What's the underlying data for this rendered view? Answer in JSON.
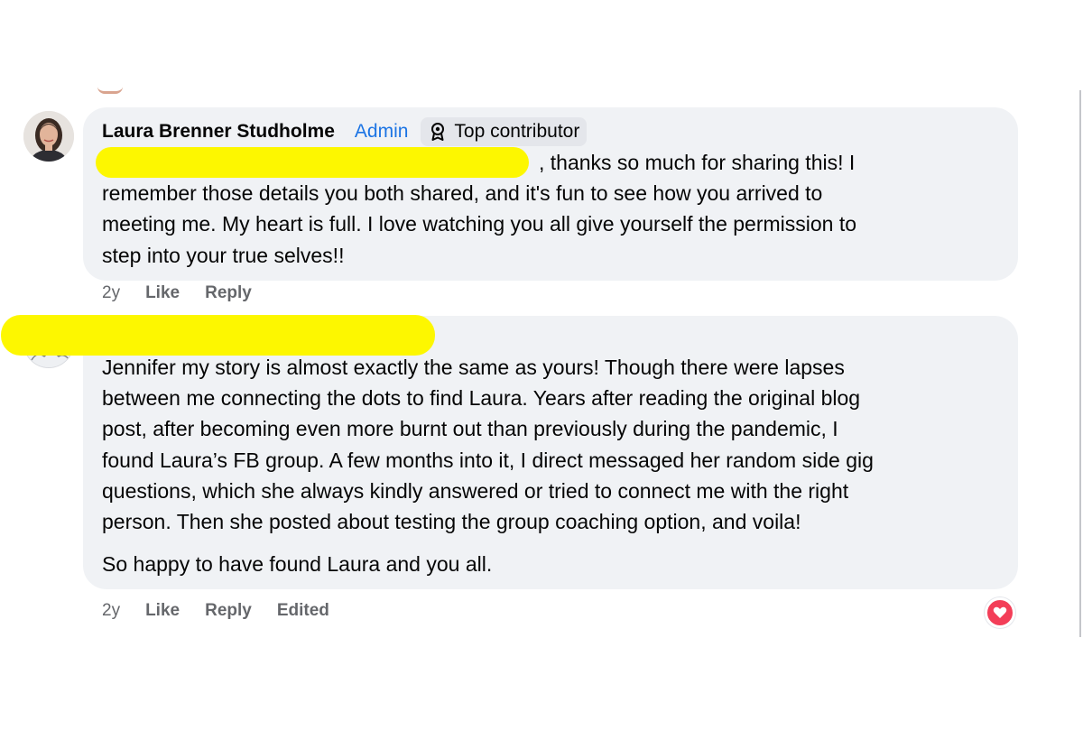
{
  "comments": [
    {
      "author": "Laura Brenner Studholme",
      "role_label": "Admin",
      "badge_label": "Top contributor",
      "badge_icon": "award-ribbon-icon",
      "lines": [
        ", thanks so much for sharing this! I",
        "remember those details you both shared, and it's fun to see how you arrived to",
        "meeting me. My heart is full. I love watching you all give yourself the permission to",
        "step into your true selves!!"
      ],
      "time": "2y",
      "like_label": "Like",
      "reply_label": "Reply"
    },
    {
      "lines": [
        "Jennifer my story is almost exactly the same as yours! Though there were lapses",
        "between me connecting the dots to find Laura. Years after reading the original blog",
        "post, after becoming even more burnt out than previously during the pandemic, I",
        "found Laura’s FB group. A few months into it, I direct messaged her random side gig",
        "questions, which she always kindly answered or tried to connect me with the right",
        "person. Then she posted about testing the group coaching option, and voila!"
      ],
      "paragraph_2": "So happy to have found Laura and you all.",
      "time": "2y",
      "like_label": "Like",
      "reply_label": "Reply",
      "edited_label": "Edited",
      "reaction_icon": "heart-reaction-icon"
    }
  ],
  "colors": {
    "bubble": "#f0f2f5",
    "admin": "#1b74e4",
    "meta_text": "#65676b",
    "redaction": "#fdf700",
    "heart": "#f33e58"
  }
}
